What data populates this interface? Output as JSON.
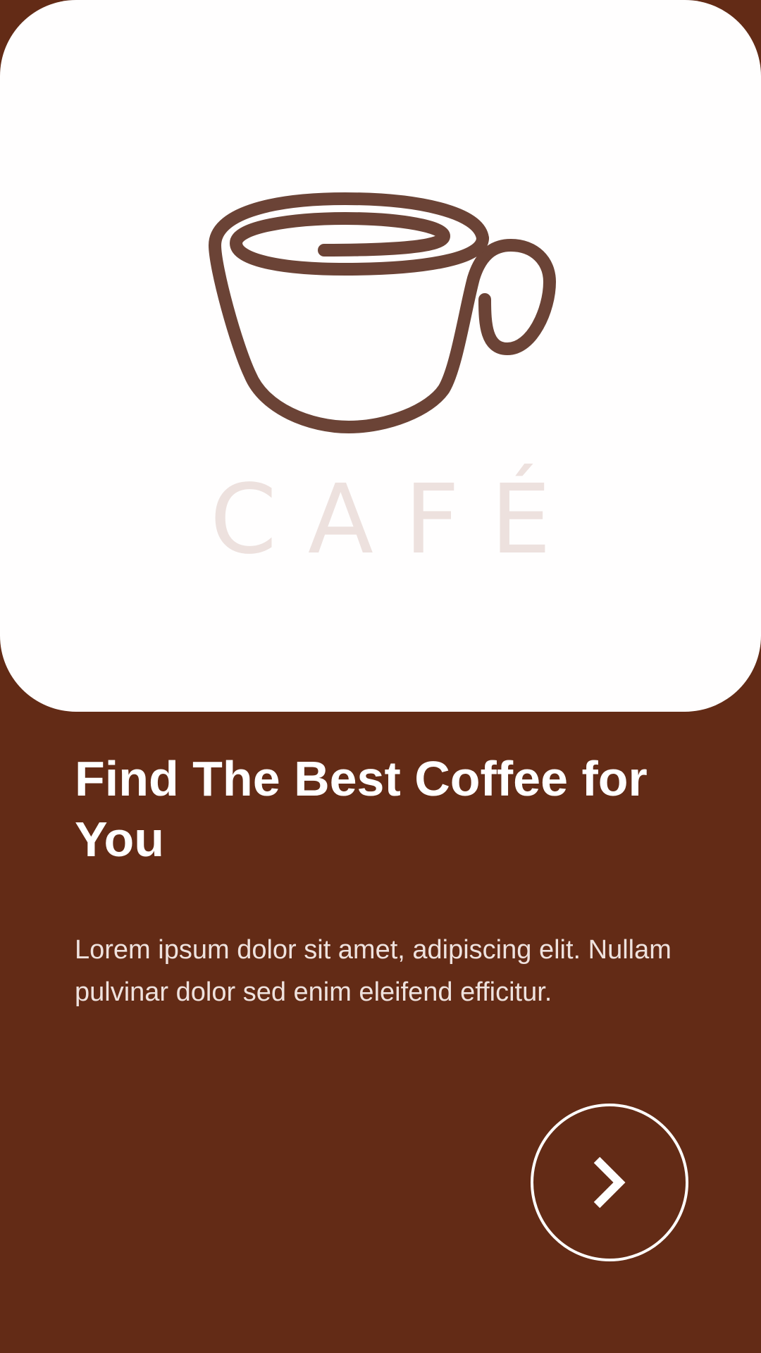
{
  "brand": {
    "wordmark": "CAFÉ",
    "logo_icon": "coffee-cup-icon"
  },
  "onboarding": {
    "headline": "Find The Best Coffee for You",
    "description": "Lorem ipsum dolor sit amet, adipiscing elit. Nullam pulvinar dolor sed enim eleifend efficitur.",
    "next_button_icon": "chevron-right-icon"
  },
  "colors": {
    "background": "#632B16",
    "card": "#FFFEFE",
    "logo_stroke": "#6B4336",
    "wordmark": "#EDE1DE",
    "text_primary": "#FFFFFF",
    "text_secondary": "#EFE2DE"
  }
}
